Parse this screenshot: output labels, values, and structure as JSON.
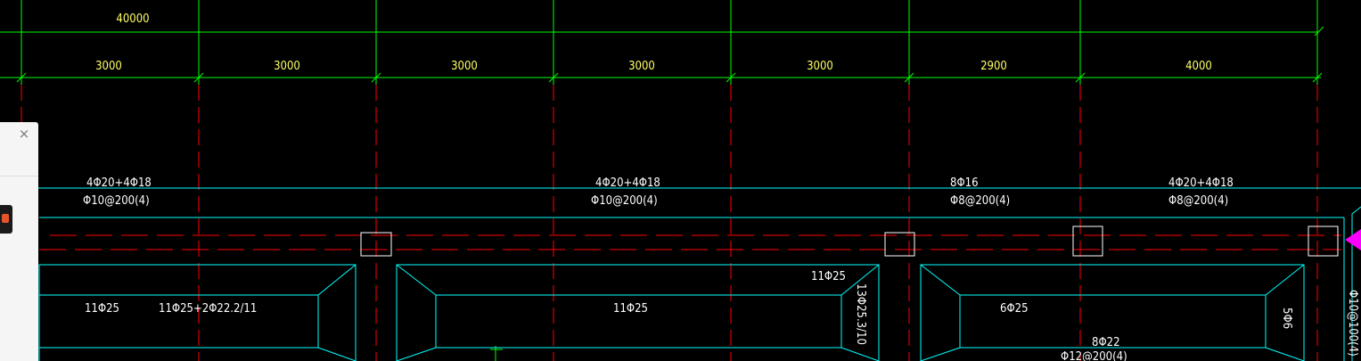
{
  "drawing": {
    "colors": {
      "background": "#000000",
      "dimension_line": "#00ff00",
      "dimension_text": "#ffff66",
      "axis_line": "#ff0000",
      "beam_outline": "#00ffff",
      "annotation_text": "#ffffff",
      "cursor_marker": "#ff00ff"
    },
    "overall_dimension": "40000",
    "bay_dimensions": [
      "3000",
      "3000",
      "3000",
      "3000",
      "3000",
      "2900",
      "4000"
    ],
    "beam_annotations": [
      {
        "main": "4Φ20+4Φ18",
        "stirrup": "Φ10@200(4)"
      },
      {
        "main": "4Φ20+4Φ18",
        "stirrup": "Φ10@200(4)"
      },
      {
        "main": "8Φ16",
        "stirrup": "Φ8@200(4)"
      },
      {
        "main": "4Φ20+4Φ18",
        "stirrup": "Φ8@200(4)"
      }
    ],
    "slab_labels": [
      "11Φ25",
      "11Φ25+2Φ22.2/11",
      "11Φ25",
      "11Φ25",
      "6Φ25",
      "8Φ22",
      "Φ12@200(4)"
    ],
    "vertical_labels": [
      "13Φ25.3/10",
      "5Φ6",
      "Φ10@100(4)"
    ]
  },
  "panel": {
    "close_symbol": "×",
    "app_icon": "app-icon"
  }
}
